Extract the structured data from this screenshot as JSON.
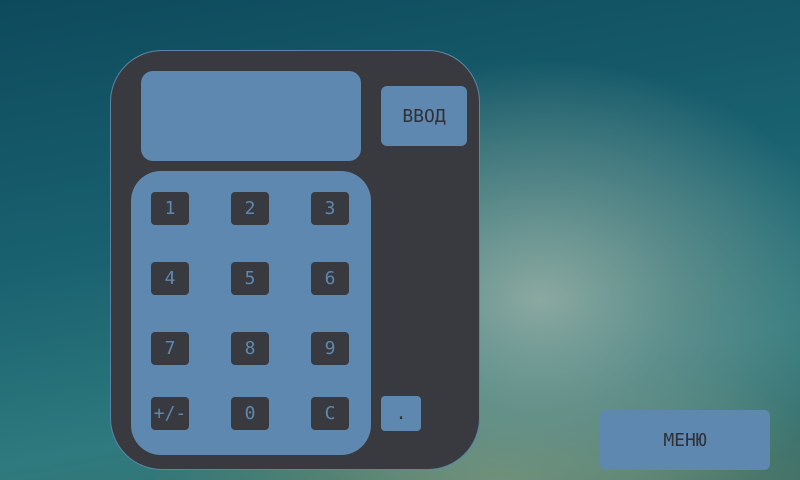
{
  "calculator": {
    "display_value": "",
    "enter_label": "ВВОД",
    "keys": [
      "1",
      "2",
      "3",
      "4",
      "5",
      "6",
      "7",
      "8",
      "9",
      "+/-",
      "0",
      "C"
    ],
    "dot_label": "."
  },
  "menu_label": "МЕНЮ",
  "colors": {
    "panel": "#393a3f",
    "accent": "#5f88b0",
    "text_dark": "#2e3136"
  }
}
